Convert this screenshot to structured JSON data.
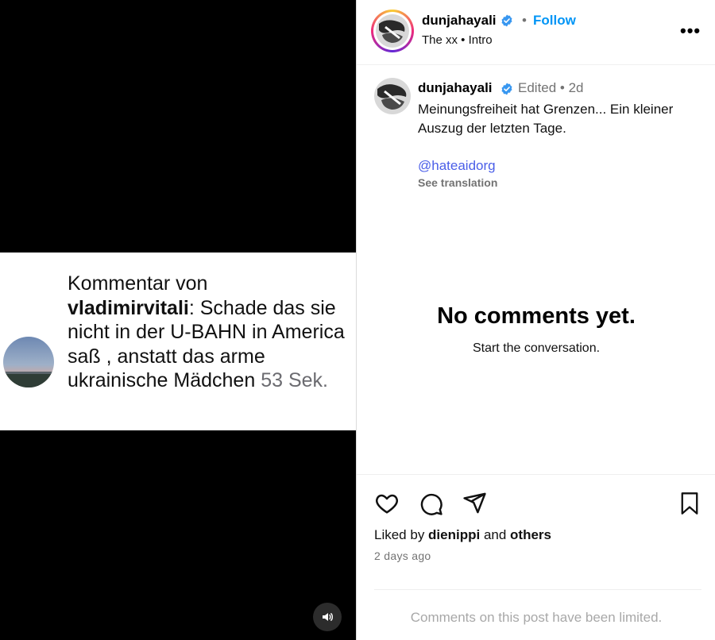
{
  "media": {
    "comment": {
      "prefix": "Kommentar von",
      "username": "vladimirvitali",
      "text": ": Schade das sie nicht in der U-BAHN in America saß , anstatt das arme ukrainische Mädchen",
      "time": "53 Sek."
    },
    "audio_icon": "speaker-icon"
  },
  "header": {
    "username": "dunjahayali",
    "separator": "•",
    "follow_label": "Follow",
    "audio_track": "The xx • Intro",
    "more_label": "•••"
  },
  "caption": {
    "username": "dunjahayali",
    "meta": "Edited •  2d",
    "text": "Meinungsfreiheit hat Grenzen... Ein kleiner Auszug der letzten Tage.",
    "mention": "@hateaidorg",
    "translate_label": "See translation"
  },
  "comments": {
    "empty_title": "No comments yet.",
    "empty_subtitle": "Start the conversation."
  },
  "footer": {
    "liked_prefix": "Liked by ",
    "liked_user": "dienippi",
    "liked_and": " and ",
    "liked_others": "others",
    "time_ago": "2 days ago",
    "limited_notice": "Comments on this post have been limited."
  },
  "colors": {
    "accent_blue": "#0095f6",
    "verified_blue": "#3897f0",
    "mention_blue": "#4a5ee8",
    "muted_gray": "#737373"
  }
}
